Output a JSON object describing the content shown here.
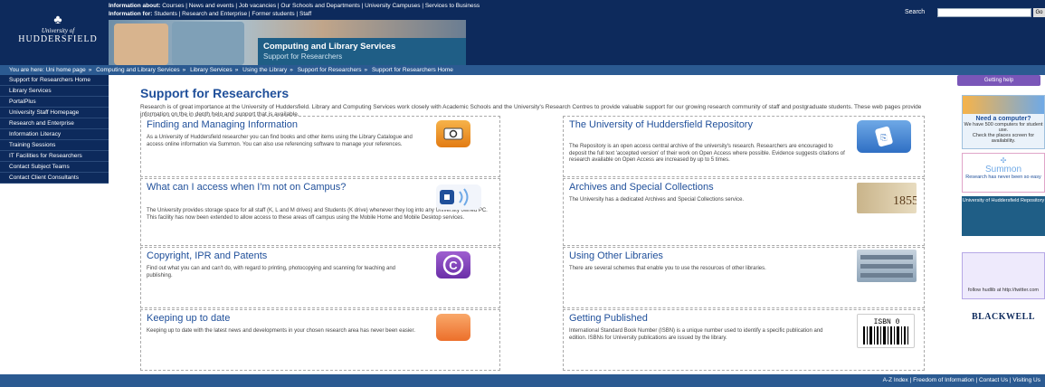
{
  "header": {
    "logo_uof": "University of",
    "logo_name": "HUDDERSFIELD",
    "topnav1_label": "Information about:",
    "topnav1_links": "Courses | News and events | Job vacancies | Our Schools and Departments | University Campuses | Services to Business",
    "topnav2_label": "Information for:",
    "topnav2_links": "Students | Research and Enterprise | Former students | Staff",
    "search_label": "Search",
    "search_value": "",
    "search_go": "Go",
    "banner_title": "Computing and Library Services",
    "banner_subtitle": "Support for Researchers"
  },
  "breadcrumb": {
    "label": "You are here:",
    "items": [
      "Uni home page",
      "Computing and Library Services",
      "Library Services",
      "Using the Library",
      "Support for Researchers",
      "Support for Researchers Home"
    ]
  },
  "leftnav": {
    "items": [
      "Support for Researchers Home",
      "Library Services",
      "PortalPlus",
      "University Staff Homepage",
      "Research and Enterprise",
      "Information Literacy",
      "Training Sessions",
      "IT Facilities for Researchers",
      "Contact Subject Teams",
      "Contact Client Consultants"
    ]
  },
  "main": {
    "title": "Support for Researchers",
    "intro": "Research is of great importance at the University of Huddersfield. Library and Computing Services work closely with Academic Schools and the University's Research Centres to provide valuable support for our growing research community of staff and postgraduate students. These web pages provide information on the in depth help and support that is available.",
    "cards": [
      {
        "title": "Finding and Managing Information",
        "text": "As a University of Huddersfield researcher you can find books and other items using the Library Catalogue and access online information via Summon. You can also use referencing software to manage your references."
      },
      {
        "title": "The University of Huddersfield Repository",
        "text": "The Repository is an open access central archive of the university's research. Researchers are encouraged to deposit the full text 'accepted version' of their work on Open Access where possible. Evidence suggests citations of research available on Open Access are increased by up to 5 times."
      },
      {
        "title": "What can I access when I'm not on Campus?",
        "text": "The University provides storage space for all staff (K, L and M drives) and Students (K drive) whenever they log into any University owned PC. This facility has now been extended to allow access to these areas off campus using the Mobile Home and Mobile Desktop services."
      },
      {
        "title": "Archives and Special Collections",
        "text": "The University has a dedicated Archives and Special Collections service."
      },
      {
        "title": "Copyright, IPR and Patents",
        "text": "Find out what you can and can't do, with regard to printing, photocopying and scanning for teaching and publishing."
      },
      {
        "title": "Using Other Libraries",
        "text": "There are several schemes that enable you to use the resources of other libraries."
      },
      {
        "title": "Keeping up to date",
        "text": "Keeping up to date with the latest news and developments in your chosen research area has never been easier."
      },
      {
        "title": "Getting Published",
        "text": "International Standard Book Number (ISBN) is a unique number used to identify a specific publication and edition. ISBNs for University publications are issued by the library."
      }
    ]
  },
  "sidebar": {
    "getting_help": "Getting help",
    "need_computer_title": "Need a computer?",
    "need_computer_text1": "We have 500 computers for student use.",
    "need_computer_text2": "Check the places screen for availability.",
    "summon_label": "Summon",
    "summon_text": "Research has never been so easy",
    "repository_label": "University of Huddersfield Repository",
    "twitter_text": "follow hudlib at http://twitter.com",
    "blackwell_label": "BLACKWELL"
  },
  "footer": {
    "links": "A-Z Index | Freedom of Information | Contact Us | Visiting Us"
  },
  "icons": {
    "card_icons": [
      "magnifier-card-icon",
      "repository-icon",
      "home-wifi-icon",
      "archive-1855-icon",
      "copyright-icon",
      "library-shelves-icon",
      "rss-icon",
      "isbn-barcode-icon"
    ]
  },
  "colors": {
    "navy": "#0d2a5c",
    "accent_blue": "#1f4f9a",
    "purple": "#7a56b8"
  }
}
